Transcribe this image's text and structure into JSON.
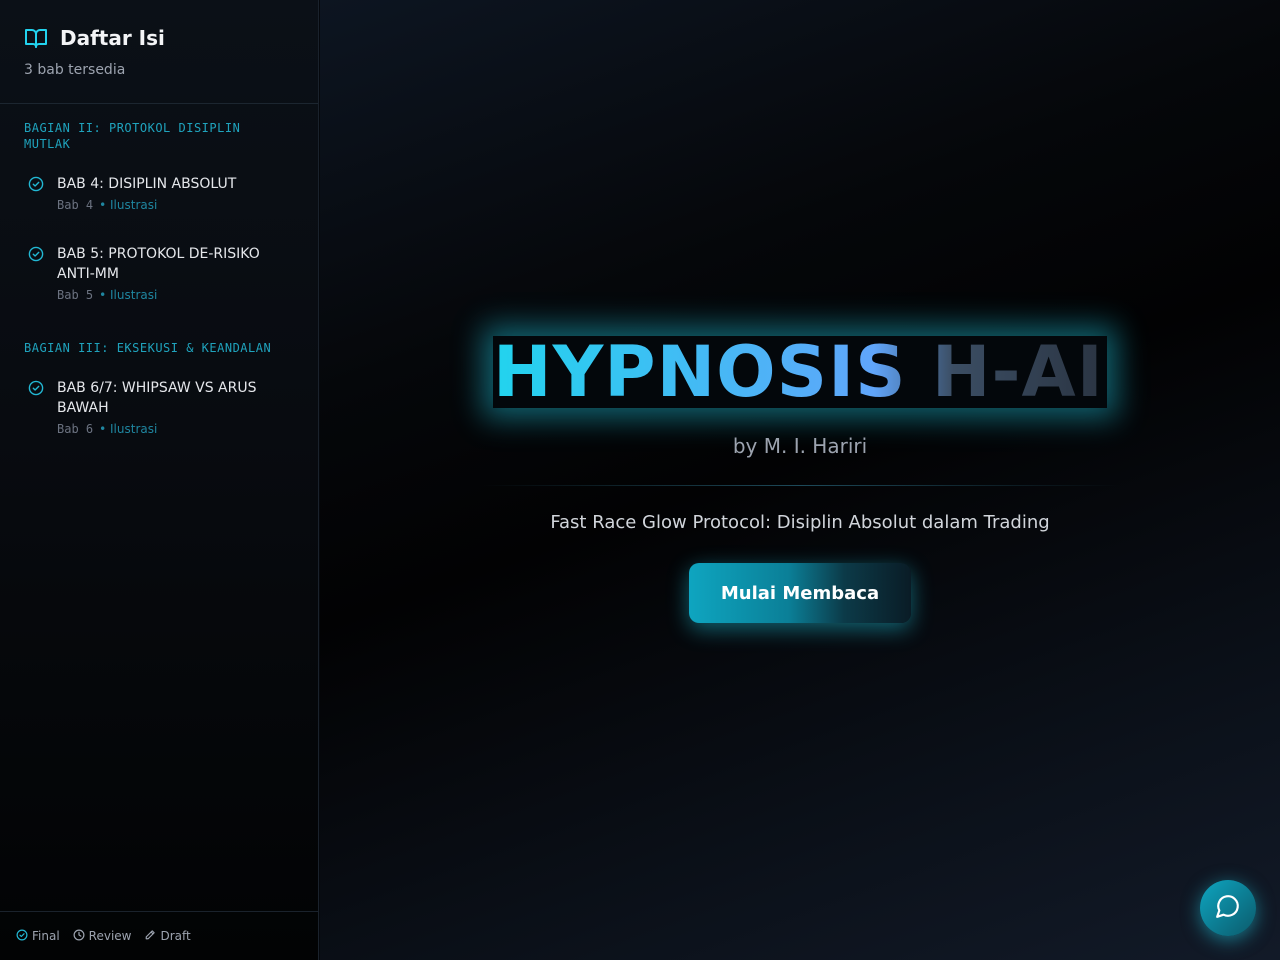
{
  "sidebar": {
    "title": "Daftar Isi",
    "subtitle": "3 bab tersedia",
    "sections": [
      {
        "label": "BAGIAN II: PROTOKOL DISIPLIN MUTLAK",
        "label_line1": "BAGIAN II: PROTOKOL DISIPLIN",
        "label_line2": "MUTLAK",
        "chapters": [
          {
            "title": "BAB 4: DISIPLIN ABSOLUT",
            "title_line1": "BAB 4: DISIPLIN ABSOLUT",
            "title_line2": "",
            "number": "Bab 4",
            "tag": "• Ilustrasi"
          },
          {
            "title": "BAB 5: PROTOKOL DE-RISIKO ANTI-MM",
            "title_line1": "BAB 5: PROTOKOL DE-RISIKO",
            "title_line2": "ANTI-MM",
            "number": "Bab 5",
            "tag": "• Ilustrasi"
          }
        ]
      },
      {
        "label": "BAGIAN III: EKSEKUSI & KEANDALAN",
        "label_line1": "BAGIAN III: EKSEKUSI & KEANDALAN",
        "label_line2": "",
        "chapters": [
          {
            "title": "BAB 6/7: WHIPSAW VS ARUS BAWAH",
            "title_line1": "BAB 6/7: WHIPSAW VS ARUS",
            "title_line2": "BAWAH",
            "number": "Bab 6",
            "tag": "• Ilustrasi"
          }
        ]
      }
    ],
    "legend": [
      {
        "icon": "check-circle-icon",
        "label": "Final"
      },
      {
        "icon": "clock-icon",
        "label": "Review"
      },
      {
        "icon": "pencil-icon",
        "label": "Draft"
      }
    ]
  },
  "main": {
    "title": "HYPNOSIS H-AI",
    "byline": "by M. I. Hariri",
    "tagline": "Fast Race Glow Protocol: Disiplin Absolut dalam Trading",
    "cta_label": "Mulai Membaca"
  },
  "chat": {
    "icon": "chat-bubble-icon"
  },
  "colors": {
    "accent": "#22d3ee",
    "accent_dark": "#0ea5c0",
    "section_label": "#1fa3bd",
    "background": "#05080d"
  }
}
